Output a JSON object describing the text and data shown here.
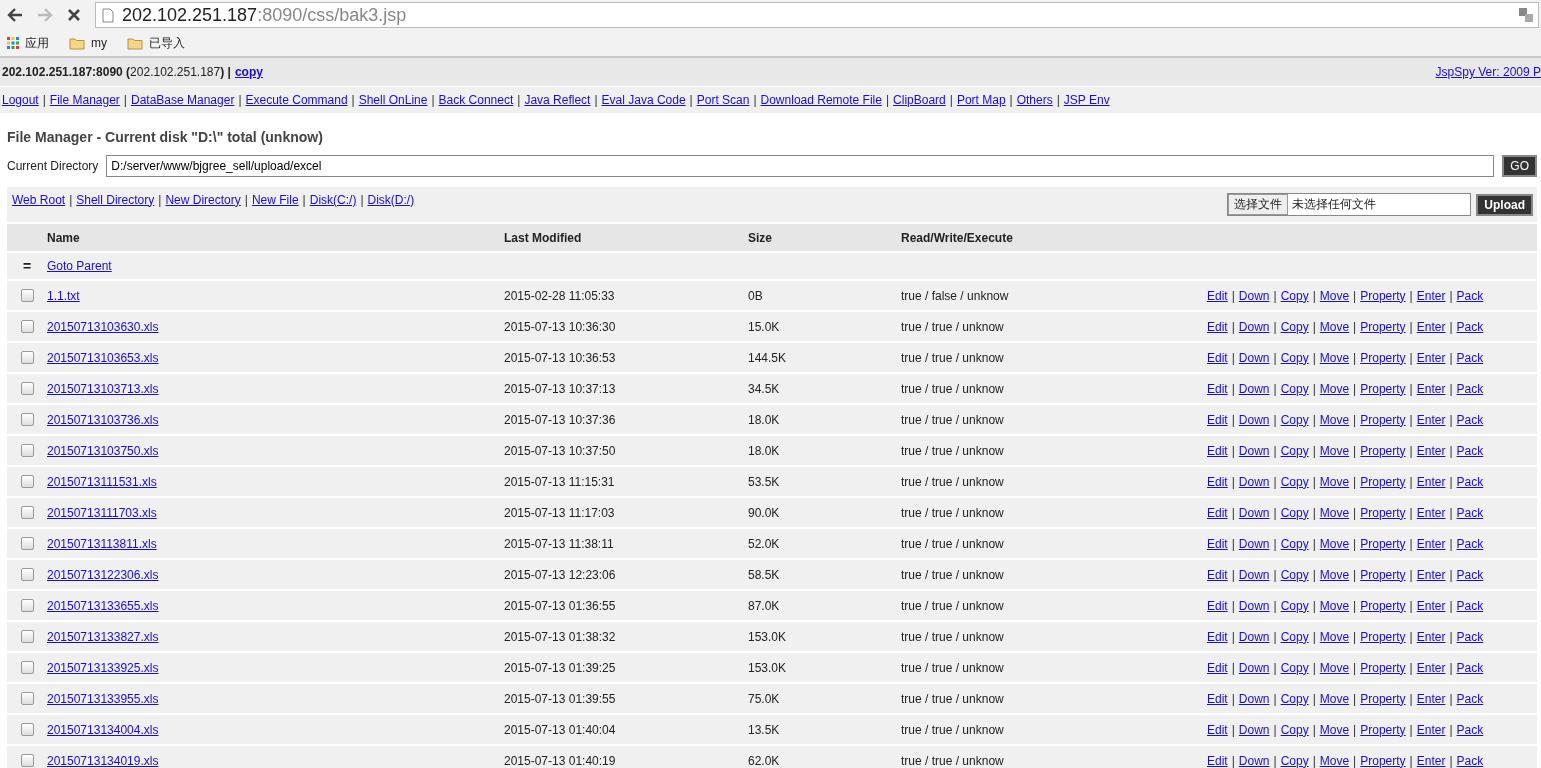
{
  "browser": {
    "url_host": "202.102.251.187",
    "url_rest": ":8090/css/bak3.jsp",
    "bookmarks": [
      {
        "kind": "apps",
        "label": "应用"
      },
      {
        "kind": "folder",
        "label": "my"
      },
      {
        "kind": "folder",
        "label": "已导入"
      }
    ]
  },
  "header": {
    "address": "**202.102.251.187:8090 (**202.102.251.187**) |**",
    "copy_link": "copy",
    "version": "JspSpy Ver: 2009 P"
  },
  "menu": {
    "separator": "|",
    "items": [
      "Logout",
      "File Manager",
      "DataBase Manager",
      "Execute Command",
      "Shell OnLine",
      "Back Connect",
      "Java Reflect",
      "Eval Java Code",
      "Port Scan",
      "Download Remote File",
      "ClipBoard",
      "Port Map",
      "Others",
      "JSP Env"
    ]
  },
  "title": "File Manager - Current disk \"D:\\\" total (unknow)",
  "directory": {
    "label": "Current Directory",
    "value": "D:/server/www/bjgree_sell/upload/excel",
    "button": "GO"
  },
  "toolbar": {
    "separator": "|",
    "links": [
      "Web Root",
      "Shell Directory",
      "New Directory",
      "New File",
      "Disk(C:/)",
      "Disk(D:/)"
    ],
    "file_button": "选择文件",
    "file_status": "未选择任何文件",
    "upload": "Upload"
  },
  "table": {
    "columns": [
      "Name",
      "Last Modified",
      "Size",
      "Read/Write/Execute"
    ],
    "parent": {
      "mark": "=",
      "label": "Goto Parent"
    },
    "action_separator": "|",
    "rows": [
      {
        "checked": false,
        "name": "1.1.txt",
        "modified": "2015-02-28 11:05:33",
        "size": "0B",
        "rwx": "true / false / unknow",
        "actions": [
          "Edit",
          "Down",
          "Copy",
          "Move",
          "Property",
          "Enter",
          "Pack"
        ]
      },
      {
        "checked": false,
        "name": "20150713103630.xls",
        "modified": "2015-07-13 10:36:30",
        "size": "15.0K",
        "rwx": "true / true / unknow",
        "actions": [
          "Edit",
          "Down",
          "Copy",
          "Move",
          "Property",
          "Enter",
          "Pack"
        ]
      },
      {
        "checked": false,
        "name": "20150713103653.xls",
        "modified": "2015-07-13 10:36:53",
        "size": "144.5K",
        "rwx": "true / true / unknow",
        "actions": [
          "Edit",
          "Down",
          "Copy",
          "Move",
          "Property",
          "Enter",
          "Pack"
        ]
      },
      {
        "checked": false,
        "name": "20150713103713.xls",
        "modified": "2015-07-13 10:37:13",
        "size": "34.5K",
        "rwx": "true / true / unknow",
        "actions": [
          "Edit",
          "Down",
          "Copy",
          "Move",
          "Property",
          "Enter",
          "Pack"
        ]
      },
      {
        "checked": false,
        "name": "20150713103736.xls",
        "modified": "2015-07-13 10:37:36",
        "size": "18.0K",
        "rwx": "true / true / unknow",
        "actions": [
          "Edit",
          "Down",
          "Copy",
          "Move",
          "Property",
          "Enter",
          "Pack"
        ]
      },
      {
        "checked": false,
        "name": "20150713103750.xls",
        "modified": "2015-07-13 10:37:50",
        "size": "18.0K",
        "rwx": "true / true / unknow",
        "actions": [
          "Edit",
          "Down",
          "Copy",
          "Move",
          "Property",
          "Enter",
          "Pack"
        ]
      },
      {
        "checked": false,
        "name": "20150713111531.xls",
        "modified": "2015-07-13 11:15:31",
        "size": "53.5K",
        "rwx": "true / true / unknow",
        "actions": [
          "Edit",
          "Down",
          "Copy",
          "Move",
          "Property",
          "Enter",
          "Pack"
        ]
      },
      {
        "checked": false,
        "name": "20150713111703.xls",
        "modified": "2015-07-13 11:17:03",
        "size": "90.0K",
        "rwx": "true / true / unknow",
        "actions": [
          "Edit",
          "Down",
          "Copy",
          "Move",
          "Property",
          "Enter",
          "Pack"
        ]
      },
      {
        "checked": false,
        "name": "20150713113811.xls",
        "modified": "2015-07-13 11:38:11",
        "size": "52.0K",
        "rwx": "true / true / unknow",
        "actions": [
          "Edit",
          "Down",
          "Copy",
          "Move",
          "Property",
          "Enter",
          "Pack"
        ]
      },
      {
        "checked": false,
        "name": "20150713122306.xls",
        "modified": "2015-07-13 12:23:06",
        "size": "58.5K",
        "rwx": "true / true / unknow",
        "actions": [
          "Edit",
          "Down",
          "Copy",
          "Move",
          "Property",
          "Enter",
          "Pack"
        ]
      },
      {
        "checked": false,
        "name": "20150713133655.xls",
        "modified": "2015-07-13 01:36:55",
        "size": "87.0K",
        "rwx": "true / true / unknow",
        "actions": [
          "Edit",
          "Down",
          "Copy",
          "Move",
          "Property",
          "Enter",
          "Pack"
        ]
      },
      {
        "checked": false,
        "name": "20150713133827.xls",
        "modified": "2015-07-13 01:38:32",
        "size": "153.0K",
        "rwx": "true / true / unknow",
        "actions": [
          "Edit",
          "Down",
          "Copy",
          "Move",
          "Property",
          "Enter",
          "Pack"
        ]
      },
      {
        "checked": false,
        "name": "20150713133925.xls",
        "modified": "2015-07-13 01:39:25",
        "size": "153.0K",
        "rwx": "true / true / unknow",
        "actions": [
          "Edit",
          "Down",
          "Copy",
          "Move",
          "Property",
          "Enter",
          "Pack"
        ]
      },
      {
        "checked": false,
        "name": "20150713133955.xls",
        "modified": "2015-07-13 01:39:55",
        "size": "75.0K",
        "rwx": "true / true / unknow",
        "actions": [
          "Edit",
          "Down",
          "Copy",
          "Move",
          "Property",
          "Enter",
          "Pack"
        ]
      },
      {
        "checked": false,
        "name": "20150713134004.xls",
        "modified": "2015-07-13 01:40:04",
        "size": "13.5K",
        "rwx": "true / true / unknow",
        "actions": [
          "Edit",
          "Down",
          "Copy",
          "Move",
          "Property",
          "Enter",
          "Pack"
        ]
      },
      {
        "checked": false,
        "name": "20150713134019.xls",
        "modified": "2015-07-13 01:40:19",
        "size": "62.0K",
        "rwx": "true / true / unknow",
        "actions": [
          "Edit",
          "Down",
          "Copy",
          "Move",
          "Property",
          "Enter",
          "Pack"
        ]
      }
    ]
  }
}
